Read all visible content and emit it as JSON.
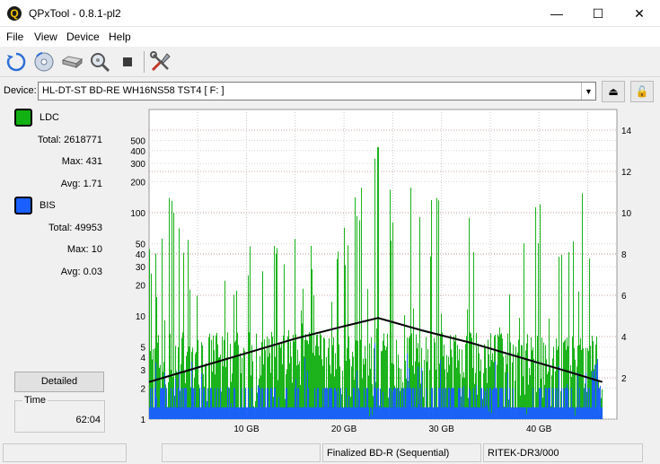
{
  "window": {
    "title": "QPxTool - 0.8.1-pl2",
    "app_icon_glyph": "Q"
  },
  "window_controls": {
    "minimize": "—",
    "maximize": "☐",
    "close": "✕"
  },
  "menu": [
    {
      "label": "File"
    },
    {
      "label": "View"
    },
    {
      "label": "Device"
    },
    {
      "label": "Help"
    }
  ],
  "toolbar": {
    "icons": [
      "refresh-icon",
      "disc-icon",
      "drive-icon",
      "scan-icon",
      "stop-icon",
      "settings-icon"
    ]
  },
  "device": {
    "label": "Device:",
    "selected": "HL-DT-ST BD-RE  WH16NS58  TST4 [ F: ]",
    "eject_glyph": "⏏",
    "lock_glyph": "🔓"
  },
  "legend": {
    "ldc": {
      "label": "LDC",
      "color": "#12b012",
      "total_label": "Total:",
      "total": "2618771",
      "max_label": "Max:",
      "max": "431",
      "avg_label": "Avg:",
      "avg": "1.71"
    },
    "bis": {
      "label": "BIS",
      "color": "#1a5fff",
      "total_label": "Total:",
      "total": "49953",
      "max_label": "Max:",
      "max": "10",
      "avg_label": "Avg:",
      "avg": "0.03"
    }
  },
  "buttons": {
    "detailed": "Detailed"
  },
  "time": {
    "label": "Time",
    "value": "62:04"
  },
  "status": {
    "cells": [
      "",
      "",
      "Finalized BD-R (Sequential)",
      "RITEK-DR3/000"
    ]
  },
  "chart_data": {
    "type": "bar",
    "x_unit": "GB",
    "x_range": [
      0,
      48
    ],
    "x_ticks": [
      10,
      20,
      30,
      40
    ],
    "x_tick_labels": [
      "10 GB",
      "20 GB",
      "30 GB",
      "40 GB"
    ],
    "y_left_scale": "log",
    "y_left_range": [
      1,
      1000
    ],
    "y_left_ticks": [
      1,
      2,
      3,
      4,
      5,
      10,
      20,
      30,
      40,
      50,
      100,
      200,
      300,
      400,
      500
    ],
    "y_right_range": [
      0,
      15
    ],
    "y_right_ticks": [
      2,
      4,
      6,
      8,
      10,
      12,
      14
    ],
    "grid": true,
    "data_end_gb": 46.5,
    "series": [
      {
        "name": "LDC",
        "color": "#12b012",
        "peak": 431,
        "peak_at_gb": 23.5,
        "envelope_gb": [
          0,
          5,
          10,
          15,
          20,
          23.5,
          24,
          26,
          30,
          35,
          40,
          45,
          46.5
        ],
        "envelope_max": [
          200,
          60,
          50,
          60,
          80,
          431,
          300,
          200,
          150,
          120,
          150,
          200,
          200
        ]
      },
      {
        "name": "BIS",
        "color": "#1a5fff",
        "max": 10,
        "envelope_gb": [
          0,
          23,
          23.5,
          24,
          30,
          40,
          46.5
        ],
        "envelope_max": [
          4,
          4,
          10,
          5,
          4,
          4,
          4
        ]
      },
      {
        "name": "Read speed",
        "color": "#000000",
        "x": [
          0,
          5,
          10,
          15,
          20,
          23.5,
          28,
          33,
          38,
          43,
          46.5
        ],
        "y": [
          1.8,
          2.5,
          3.2,
          3.9,
          4.5,
          4.9,
          4.3,
          3.7,
          3.0,
          2.3,
          1.8
        ]
      }
    ]
  }
}
